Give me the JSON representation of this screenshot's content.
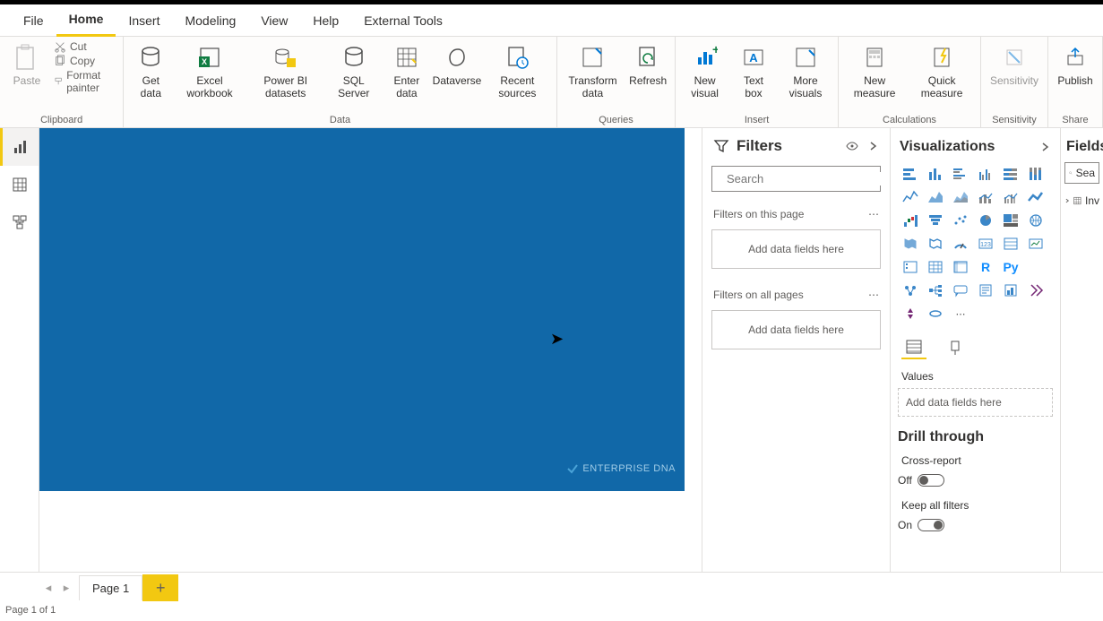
{
  "menu": [
    "File",
    "Home",
    "Insert",
    "Modeling",
    "View",
    "Help",
    "External Tools"
  ],
  "active_menu": 1,
  "ribbon": {
    "clipboard": {
      "paste": "Paste",
      "cut": "Cut",
      "copy": "Copy",
      "format_painter": "Format painter",
      "label": "Clipboard"
    },
    "data": {
      "get_data": "Get data",
      "excel": "Excel workbook",
      "pbi_ds": "Power BI datasets",
      "sql": "SQL Server",
      "enter": "Enter data",
      "dataverse": "Dataverse",
      "recent": "Recent sources",
      "label": "Data"
    },
    "queries": {
      "transform": "Transform data",
      "refresh": "Refresh",
      "label": "Queries"
    },
    "insert": {
      "new_visual": "New visual",
      "text_box": "Text box",
      "more": "More visuals",
      "label": "Insert"
    },
    "calc": {
      "new_measure": "New measure",
      "quick_measure": "Quick measure",
      "label": "Calculations"
    },
    "sensitivity": {
      "btn": "Sensitivity",
      "label": "Sensitivity"
    },
    "share": {
      "publish": "Publish",
      "label": "Share"
    }
  },
  "filters": {
    "title": "Filters",
    "search_placeholder": "Search",
    "on_page": "Filters on this page",
    "on_all": "Filters on all pages",
    "drop": "Add data fields here"
  },
  "viz": {
    "title": "Visualizations",
    "values": "Values",
    "drop": "Add data fields here",
    "drill": "Drill through",
    "cross": "Cross-report",
    "cross_state": "Off",
    "keep": "Keep all filters",
    "keep_state": "On"
  },
  "fields": {
    "title": "Fields",
    "search_placeholder": "Sea",
    "tree_item": "Inv"
  },
  "canvas": {
    "watermark": "ENTERPRISE DNA"
  },
  "pages": {
    "tab1": "Page 1",
    "status": "Page 1 of 1"
  }
}
